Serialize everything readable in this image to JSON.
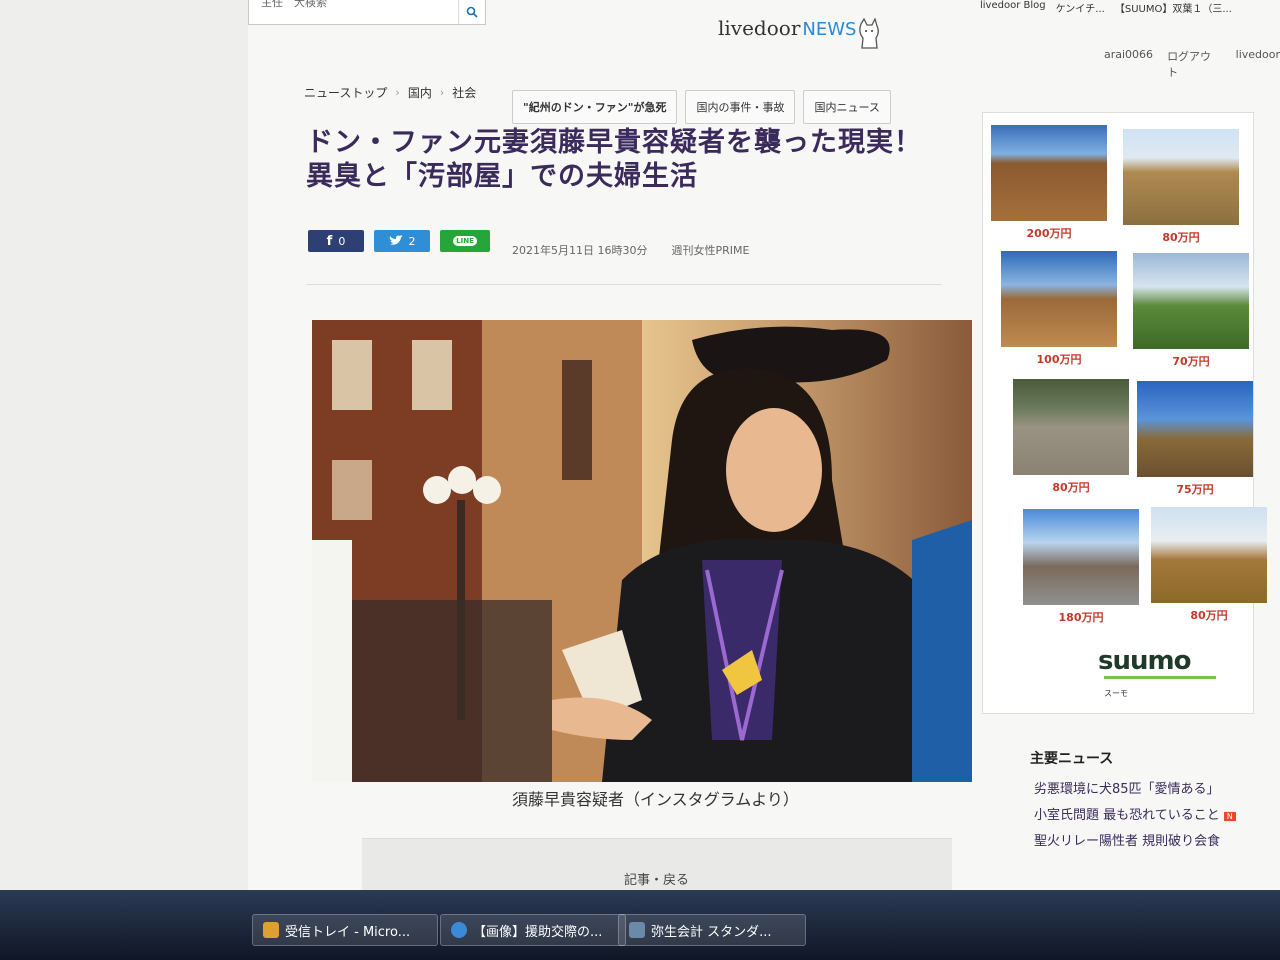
{
  "topbar": {
    "search_text": "主任　大検索",
    "brand_livedoor": "livedoor",
    "brand_news": "NEWS",
    "links": [
      "livedoor Blog",
      "ケンイチ...",
      "【SUUMO】双葉１（三..."
    ],
    "user": "arai0066",
    "logout": "ログアウト",
    "site": "livedoor"
  },
  "breadcrumb": [
    "ニューストップ",
    "国内",
    "社会"
  ],
  "tags": [
    "\"紀州のドン・ファン\"が急死",
    "国内の事件・事故",
    "国内ニュース"
  ],
  "article": {
    "title_line1": "ドン・ファン元妻須藤早貴容疑者を襲った現実！",
    "title_line2": "異臭と「汚部屋」での夫婦生活",
    "fb_count": "0",
    "tw_count": "2",
    "line_label": "LINE",
    "date": "2021年5月11日 16時30分",
    "source": "週刊女性PRIME",
    "caption": "須藤早貴容疑者（インスタグラムより）",
    "next_label": "記事・戻る"
  },
  "ads": {
    "prices": [
      "200万円",
      "80万円",
      "100万円",
      "70万円",
      "80万円",
      "75万円",
      "180万円",
      "80万円"
    ],
    "brand": "suumo",
    "brand_sub": "スーモ"
  },
  "sidebar": {
    "heading": "主要ニュース",
    "items": [
      "劣悪環境に犬85匹「愛情ある」",
      "小室氏問題 最も恐れていること",
      "聖火リレー陽性者 規則破り会食"
    ]
  },
  "taskbar": {
    "items": [
      "受信トレイ - Micro...",
      "【画像】援助交際の...",
      "弥生会計 スタンダ..."
    ]
  }
}
